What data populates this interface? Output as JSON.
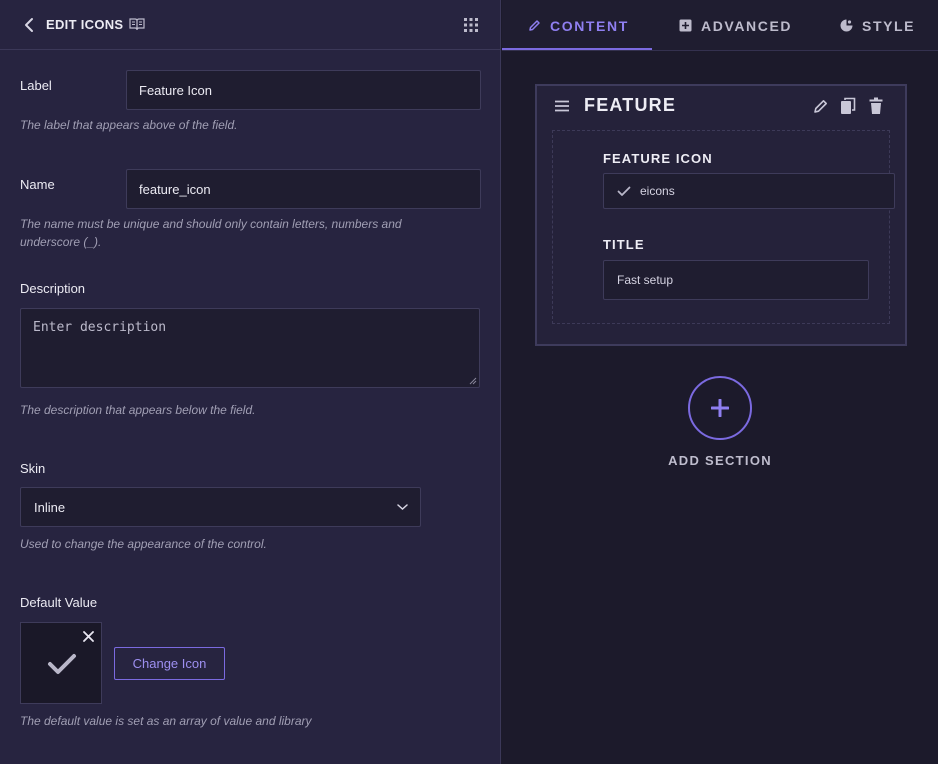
{
  "colors": {
    "accent": "#7b6ae0",
    "panel_bg": "#272440",
    "canvas_bg": "#1c1a2b",
    "input_bg": "#1f1d30"
  },
  "left_panel": {
    "header": {
      "title": "EDIT ICONS",
      "back_icon": "chevron-left-icon",
      "docs_icon": "book-open-icon",
      "grid_icon": "grid-icon"
    },
    "fields": {
      "label": {
        "label": "Label",
        "value": "Feature Icon",
        "help": "The label that appears above of the field."
      },
      "name": {
        "label": "Name",
        "value": "feature_icon",
        "help": "The name must be unique and should only contain letters, numbers and underscore (_)."
      },
      "description": {
        "label": "Description",
        "placeholder": "Enter description",
        "help": "The description that appears below the field."
      },
      "skin": {
        "label": "Skin",
        "selected": "Inline",
        "help": "Used to change the appearance of the control."
      },
      "default_value": {
        "label": "Default Value",
        "icon": "check-icon",
        "change_button": "Change Icon",
        "help": "The default value is set as an array of value and library"
      }
    }
  },
  "right_panel": {
    "tabs": [
      {
        "label": "CONTENT",
        "icon": "pencil-icon",
        "active": true
      },
      {
        "label": "ADVANCED",
        "icon": "layout-icon",
        "active": false
      },
      {
        "label": "STYLE",
        "icon": "palette-icon",
        "active": false
      }
    ],
    "section": {
      "title": "FEATURE",
      "fields": [
        {
          "label": "FEATURE ICON",
          "value": "eicons",
          "icon": "check-icon"
        },
        {
          "label": "TITLE",
          "value": "Fast setup"
        }
      ]
    },
    "add_section": {
      "label": "ADD SECTION"
    }
  }
}
